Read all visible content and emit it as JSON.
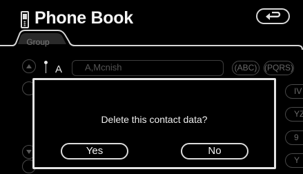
{
  "header": {
    "title": "Phone Book",
    "phone_icon": "phonebook-icon",
    "back_icon": "return-arrow-icon"
  },
  "tabs": [
    {
      "label": "Group",
      "active": false
    }
  ],
  "list": {
    "section_letter": "A",
    "entries": [
      {
        "name": "A,Mcnish"
      }
    ]
  },
  "index_buttons": {
    "top": [
      "(ABC)",
      "(PQRS)"
    ],
    "side": [
      "IV",
      "YZ",
      "9",
      "Y"
    ]
  },
  "dialog": {
    "message": "Delete this contact data?",
    "yes_label": "Yes",
    "no_label": "No"
  },
  "colors": {
    "background": "#000000",
    "foreground": "#f2f2f2",
    "dimmed": "#4a4a4a"
  }
}
